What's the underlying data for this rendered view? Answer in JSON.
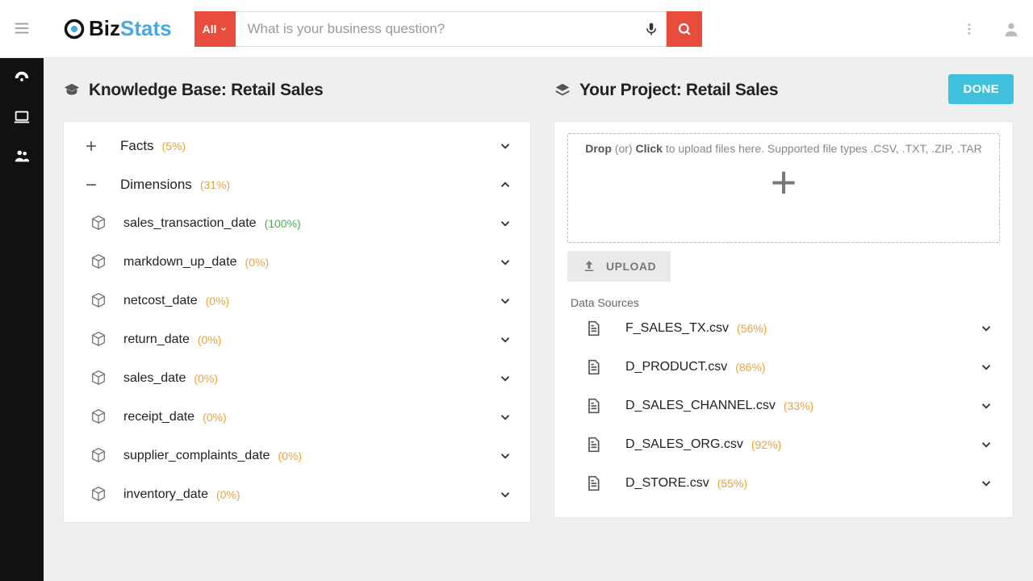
{
  "header": {
    "logo": {
      "biz": "Biz",
      "stats": "Stats"
    },
    "all_label": "All",
    "search_placeholder": "What is your business question?"
  },
  "knowledge_base": {
    "title": "Knowledge Base: Retail Sales",
    "facts": {
      "label": "Facts",
      "pct": "(5%)"
    },
    "dimensions": {
      "label": "Dimensions",
      "pct": "(31%)"
    },
    "items": [
      {
        "label": "sales_transaction_date",
        "pct": "(100%)",
        "green": true
      },
      {
        "label": "markdown_up_date",
        "pct": "(0%)"
      },
      {
        "label": "netcost_date",
        "pct": "(0%)"
      },
      {
        "label": "return_date",
        "pct": "(0%)"
      },
      {
        "label": "sales_date",
        "pct": "(0%)"
      },
      {
        "label": "receipt_date",
        "pct": "(0%)"
      },
      {
        "label": "supplier_complaints_date",
        "pct": "(0%)"
      },
      {
        "label": "inventory_date",
        "pct": "(0%)"
      }
    ]
  },
  "project": {
    "title": "Your Project: Retail Sales",
    "done_label": "DONE",
    "dropzone": {
      "drop": "Drop",
      "or": "(or)",
      "click": "Click",
      "rest": "to upload files here. Supported file types .CSV, .TXT, .ZIP, .TAR"
    },
    "upload_label": "UPLOAD",
    "ds_title": "Data Sources",
    "sources": [
      {
        "label": "F_SALES_TX.csv",
        "pct": "(56%)"
      },
      {
        "label": "D_PRODUCT.csv",
        "pct": "(86%)"
      },
      {
        "label": "D_SALES_CHANNEL.csv",
        "pct": "(33%)"
      },
      {
        "label": "D_SALES_ORG.csv",
        "pct": "(92%)"
      },
      {
        "label": "D_STORE.csv",
        "pct": "(55%)"
      }
    ]
  }
}
